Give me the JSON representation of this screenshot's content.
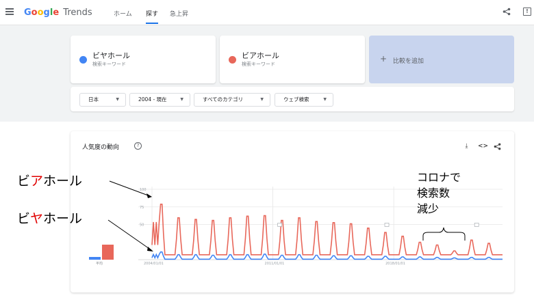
{
  "header": {
    "logo_google": [
      "G",
      "o",
      "o",
      "g",
      "l",
      "e"
    ],
    "logo_trends": "Trends",
    "nav": [
      {
        "label": "ホーム"
      },
      {
        "label": "探す"
      },
      {
        "label": "急上昇"
      }
    ]
  },
  "terms": [
    {
      "name": "ビヤホール",
      "type": "検索キーワード",
      "color": "#4285f4"
    },
    {
      "name": "ビアホール",
      "type": "検索キーワード",
      "color": "#e8675a"
    }
  ],
  "add_compare": {
    "label": "比較を追加"
  },
  "filters": [
    {
      "label": "日本"
    },
    {
      "label": "2004 - 現在"
    },
    {
      "label": "すべてのカテゴリ"
    },
    {
      "label": "ウェブ検索"
    }
  ],
  "interest": {
    "title": "人気度の動向",
    "average_label": "平均"
  },
  "chart_data": {
    "type": "line",
    "x_ticks": [
      "2004/01/01",
      "2011/01/01",
      "2018/01/01"
    ],
    "y_ticks": [
      "100",
      "75",
      "50"
    ],
    "ylim": [
      0,
      100
    ],
    "series": [
      {
        "name": "ビアホール",
        "color": "#e8675a",
        "averages": 20,
        "peaks": [
          100,
          75,
          72,
          70,
          75,
          78,
          79,
          70,
          75,
          68,
          66,
          64,
          56,
          48,
          41,
          30,
          25,
          14,
          34,
          28,
          26,
          26,
          28,
          34
        ]
      },
      {
        "name": "ビヤホール",
        "color": "#4285f4",
        "averages": 2,
        "peaks": [
          14,
          9,
          9,
          8,
          9,
          9,
          10,
          8,
          9,
          8,
          7,
          7,
          6,
          6,
          5,
          5,
          4,
          3,
          4,
          4,
          4,
          4,
          4,
          4
        ]
      }
    ],
    "legend": "none"
  },
  "annotations": {
    "beer_hall": {
      "pre": "ビ",
      "mid": "ア",
      "post": "ホール"
    },
    "biya_hall": {
      "pre": "ビ",
      "mid": "ヤ",
      "post": "ホール"
    },
    "covid_lines": [
      "コロナで",
      "検索数",
      "減少"
    ]
  }
}
